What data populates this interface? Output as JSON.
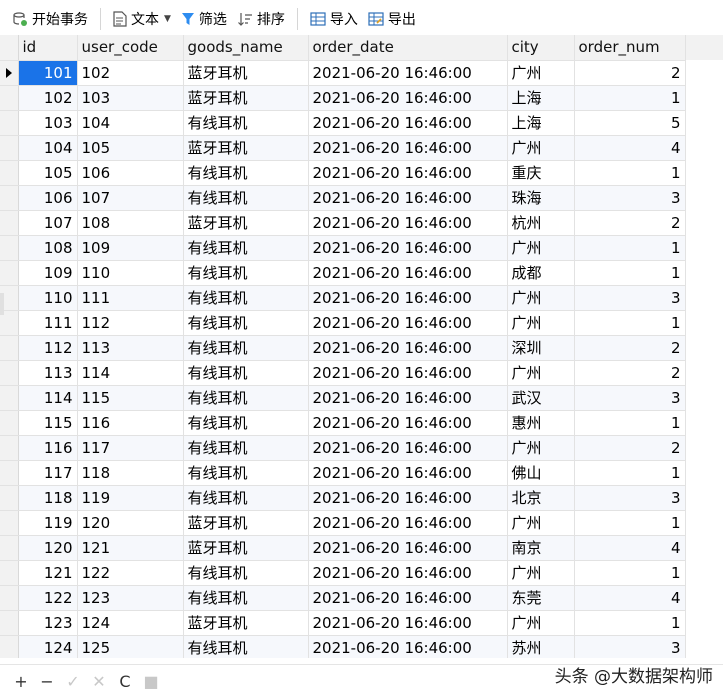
{
  "toolbar": {
    "begin_transaction": "开始事务",
    "text": "文本",
    "filter": "筛选",
    "sort": "排序",
    "import": "导入",
    "export": "导出"
  },
  "table": {
    "columns": [
      "id",
      "user_code",
      "goods_name",
      "order_date",
      "city",
      "order_num"
    ],
    "rows": [
      [
        "101",
        "102",
        "蓝牙耳机",
        "2021-06-20 16:46:00",
        "广州",
        "2"
      ],
      [
        "102",
        "103",
        "蓝牙耳机",
        "2021-06-20 16:46:00",
        "上海",
        "1"
      ],
      [
        "103",
        "104",
        "有线耳机",
        "2021-06-20 16:46:00",
        "上海",
        "5"
      ],
      [
        "104",
        "105",
        "蓝牙耳机",
        "2021-06-20 16:46:00",
        "广州",
        "4"
      ],
      [
        "105",
        "106",
        "有线耳机",
        "2021-06-20 16:46:00",
        "重庆",
        "1"
      ],
      [
        "106",
        "107",
        "有线耳机",
        "2021-06-20 16:46:00",
        "珠海",
        "3"
      ],
      [
        "107",
        "108",
        "蓝牙耳机",
        "2021-06-20 16:46:00",
        "杭州",
        "2"
      ],
      [
        "108",
        "109",
        "有线耳机",
        "2021-06-20 16:46:00",
        "广州",
        "1"
      ],
      [
        "109",
        "110",
        "有线耳机",
        "2021-06-20 16:46:00",
        "成都",
        "1"
      ],
      [
        "110",
        "111",
        "有线耳机",
        "2021-06-20 16:46:00",
        "广州",
        "3"
      ],
      [
        "111",
        "112",
        "有线耳机",
        "2021-06-20 16:46:00",
        "广州",
        "1"
      ],
      [
        "112",
        "113",
        "有线耳机",
        "2021-06-20 16:46:00",
        "深圳",
        "2"
      ],
      [
        "113",
        "114",
        "有线耳机",
        "2021-06-20 16:46:00",
        "广州",
        "2"
      ],
      [
        "114",
        "115",
        "有线耳机",
        "2021-06-20 16:46:00",
        "武汉",
        "3"
      ],
      [
        "115",
        "116",
        "有线耳机",
        "2021-06-20 16:46:00",
        "惠州",
        "1"
      ],
      [
        "116",
        "117",
        "有线耳机",
        "2021-06-20 16:46:00",
        "广州",
        "2"
      ],
      [
        "117",
        "118",
        "有线耳机",
        "2021-06-20 16:46:00",
        "佛山",
        "1"
      ],
      [
        "118",
        "119",
        "有线耳机",
        "2021-06-20 16:46:00",
        "北京",
        "3"
      ],
      [
        "119",
        "120",
        "蓝牙耳机",
        "2021-06-20 16:46:00",
        "广州",
        "1"
      ],
      [
        "120",
        "121",
        "蓝牙耳机",
        "2021-06-20 16:46:00",
        "南京",
        "4"
      ],
      [
        "121",
        "122",
        "有线耳机",
        "2021-06-20 16:46:00",
        "广州",
        "1"
      ],
      [
        "122",
        "123",
        "有线耳机",
        "2021-06-20 16:46:00",
        "东莞",
        "4"
      ],
      [
        "123",
        "124",
        "蓝牙耳机",
        "2021-06-20 16:46:00",
        "广州",
        "1"
      ],
      [
        "124",
        "125",
        "有线耳机",
        "2021-06-20 16:46:00",
        "苏州",
        "3"
      ]
    ],
    "selected_row": 0
  },
  "bottom_bar": {
    "add": "+",
    "remove": "−",
    "apply": "✓",
    "discard": "✕",
    "refresh": "C",
    "stop": "■"
  },
  "watermark": "头条 @大数据架构师",
  "colors": {
    "selection": "#1a73e8",
    "header_bg": "#f2f2f2",
    "alt_row": "#f6f8fc"
  }
}
